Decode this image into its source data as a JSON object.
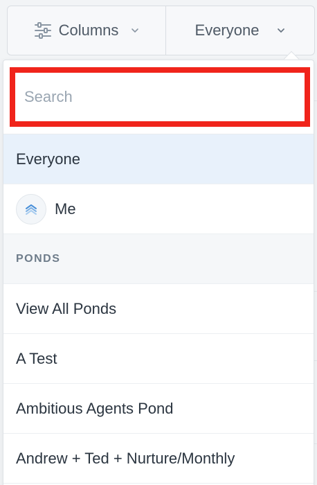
{
  "toolbar": {
    "columns_label": "Columns",
    "everyone_label": "Everyone"
  },
  "dropdown": {
    "search_placeholder": "Search",
    "search_value": "",
    "items": [
      {
        "label": "Everyone",
        "selected": true
      },
      {
        "label": "Me",
        "icon": "agent-avatar-icon"
      }
    ],
    "section": {
      "title": "PONDS",
      "items": [
        {
          "label": "View All Ponds"
        },
        {
          "label": "A Test"
        },
        {
          "label": "Ambitious Agents Pond"
        },
        {
          "label": "Andrew + Ted + Nurture/Monthly"
        }
      ]
    }
  },
  "colors": {
    "highlight": "#f0241b",
    "selected_bg": "#e8f1fb",
    "avatar_accent": "#4a90d9"
  }
}
